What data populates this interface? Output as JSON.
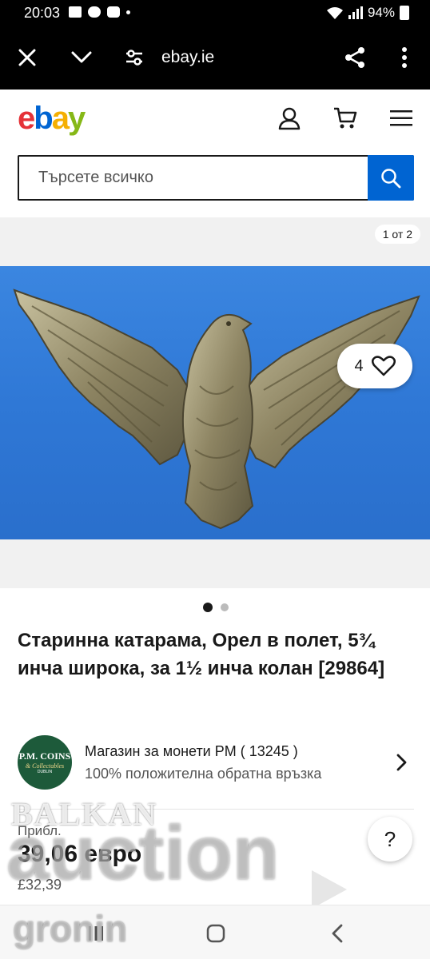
{
  "status_bar": {
    "time": "20:03",
    "battery": "94%"
  },
  "browser": {
    "url": "ebay.ie",
    "icons": [
      "close-icon",
      "chevron-down-icon",
      "site-settings-icon",
      "share-icon",
      "more-vert-icon"
    ]
  },
  "header": {
    "logo": {
      "e": "e",
      "b": "b",
      "a": "a",
      "y": "y"
    },
    "brand_colors": {
      "red": "#e53238",
      "blue": "#0064d2",
      "yellow": "#f5af02",
      "green": "#86b817"
    }
  },
  "search": {
    "placeholder": "Търсете всичко",
    "value": ""
  },
  "gallery": {
    "counter": "1 от 2",
    "watch_count": "4",
    "total_images": 2,
    "active_index": 1
  },
  "listing": {
    "title": "Старинна катарама, Орел в полет, 5¾ инча широка, за 1½ инча колан [29864]",
    "seller_name": "Магазин за монети PM ( 13245 )",
    "seller_feedback": "100% положителна обратна връзка",
    "seller_logo": {
      "line1": "P.M. COINS",
      "line2": "& Collectables",
      "line3": "DUBLIN"
    },
    "price_approx_label": "Прибл.",
    "price": "39,06 евро",
    "price_gbp": "£32,39",
    "help_label": "?"
  },
  "watermark": {
    "line1": "BALKAN",
    "line2": "auction",
    "line3": "gronin"
  }
}
